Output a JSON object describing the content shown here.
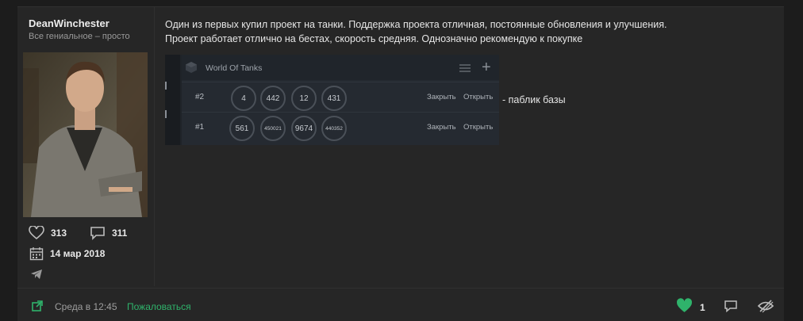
{
  "author": {
    "username": "DeanWinchester",
    "title": "Все гениальное – просто",
    "likes": "313",
    "messages": "311",
    "joined": "14 мар 2018"
  },
  "post": {
    "line1": "Один из первых купил проект на танки. Поддержка проекта отличная, постоянные обновления и улучшения.",
    "line2": "Проект работает отлично на бестах, скорость средняя. Однозначно рекомендую к покупке",
    "aside": "- паблик базы"
  },
  "embed": {
    "title": "World Of Tanks",
    "rows": [
      {
        "idx": "#2",
        "values": [
          "4",
          "442",
          "12",
          "431"
        ],
        "close": "Закрыть",
        "open": "Открыть"
      },
      {
        "idx": "#1",
        "values": [
          "561",
          "450021",
          "9674",
          "440352"
        ],
        "close": "Закрыть",
        "open": "Открыть"
      }
    ]
  },
  "footer": {
    "time": "Среда в 12:45",
    "report": "Пожаловаться",
    "like_count": "1"
  },
  "colors": {
    "accent_green": "#2fb36b",
    "background": "#262626",
    "page": "#1c1c1c"
  },
  "icons": [
    "heart-icon",
    "chat-bubble-icon",
    "calendar-icon",
    "telegram-icon",
    "external-link-icon",
    "quote-icon",
    "hide-icon"
  ]
}
